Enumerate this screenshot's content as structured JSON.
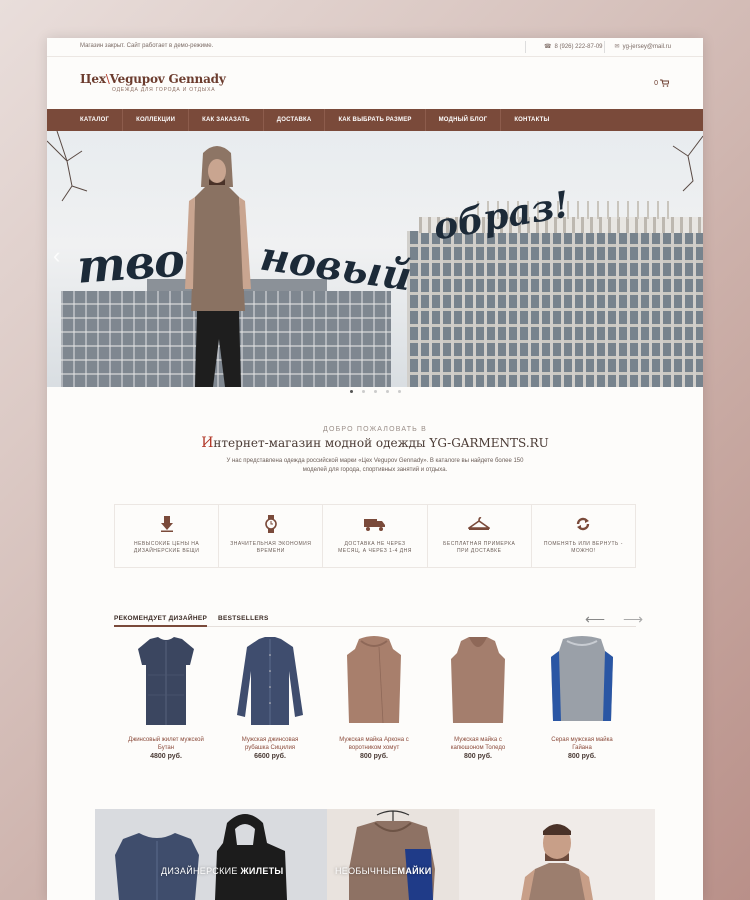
{
  "topbar": {
    "notice": "Магазин закрыт. Сайт работает в демо-режиме.",
    "phone": "8 (926) 222-87-09",
    "email": "yg-jersey@mail.ru"
  },
  "header": {
    "logo_main_a": "Цех",
    "logo_main_b": "Vegupov Gennady",
    "logo_sub": "ОДЕЖДА ДЛЯ ГОРОДА И ОТДЫХА",
    "cart_count": "0"
  },
  "nav": {
    "items": [
      "КАТАЛОГ",
      "КОЛЛЕКЦИИ",
      "КАК ЗАКАЗАТЬ",
      "ДОСТАВКА",
      "КАК ВЫБРАТЬ РАЗМЕР",
      "МОДНЫЙ БЛОГ",
      "КОНТАКТЫ"
    ]
  },
  "hero": {
    "word1": "твой",
    "word2": "новый",
    "word3": "образ!"
  },
  "welcome": {
    "pre": "ДОБРО ПОЖАЛОВАТЬ В",
    "title_first": "И",
    "title_rest": "нтернет-магазин модной одежды YG-GARMENTS.RU",
    "text": "У нас представлена одежда российской марки «Цех Vegupov Gennady». В каталоге вы найдете более 150 моделей для города, спортивных занятий и отдыха."
  },
  "features": [
    {
      "label": "НЕВЫСОКИЕ ЦЕНЫ НА ДИЗАЙНЕРСКИЕ ВЕЩИ",
      "icon": "price-down-icon"
    },
    {
      "label": "ЗНАЧИТЕЛЬНАЯ ЭКОНОМИЯ ВРЕМЕНИ",
      "icon": "watch-icon"
    },
    {
      "label": "ДОСТАВКА НЕ ЧЕРЕЗ МЕСЯЦ, А ЧЕРЕЗ 1-4 ДНЯ",
      "icon": "truck-icon"
    },
    {
      "label": "БЕСПЛАТНАЯ ПРИМЕРКА ПРИ ДОСТАВКЕ",
      "icon": "hanger-icon"
    },
    {
      "label": "ПОМЕНЯТЬ ИЛИ ВЕРНУТЬ - МОЖНО!",
      "icon": "exchange-icon"
    }
  ],
  "tabs": {
    "recommended": "РЕКОМЕНДУЕТ ДИЗАЙНЕР",
    "bestsellers": "BESTSELLERS"
  },
  "products": [
    {
      "name": "Джинсовый жилет мужской Бутан",
      "price": "4800 руб."
    },
    {
      "name": "Мужская джинсовая рубашка Сицилия",
      "price": "6600 руб."
    },
    {
      "name": "Мужская майка Аркона с воротником хомут",
      "price": "800 руб."
    },
    {
      "name": "Мужская майка с капюшоном Толедо",
      "price": "800 руб."
    },
    {
      "name": "Серая мужская майка Гайана",
      "price": "800 руб."
    }
  ],
  "banners": {
    "b1_light": "ДИЗАЙНЕРСКИЕ ",
    "b1_bold": "ЖИЛЕТЫ",
    "b2_light": "НЕОБЫЧНЫЕ",
    "b2_bold": "МАЙКИ"
  },
  "colors": {
    "brand_brown": "#7a4a3a",
    "accent_red": "#b23a2a"
  }
}
